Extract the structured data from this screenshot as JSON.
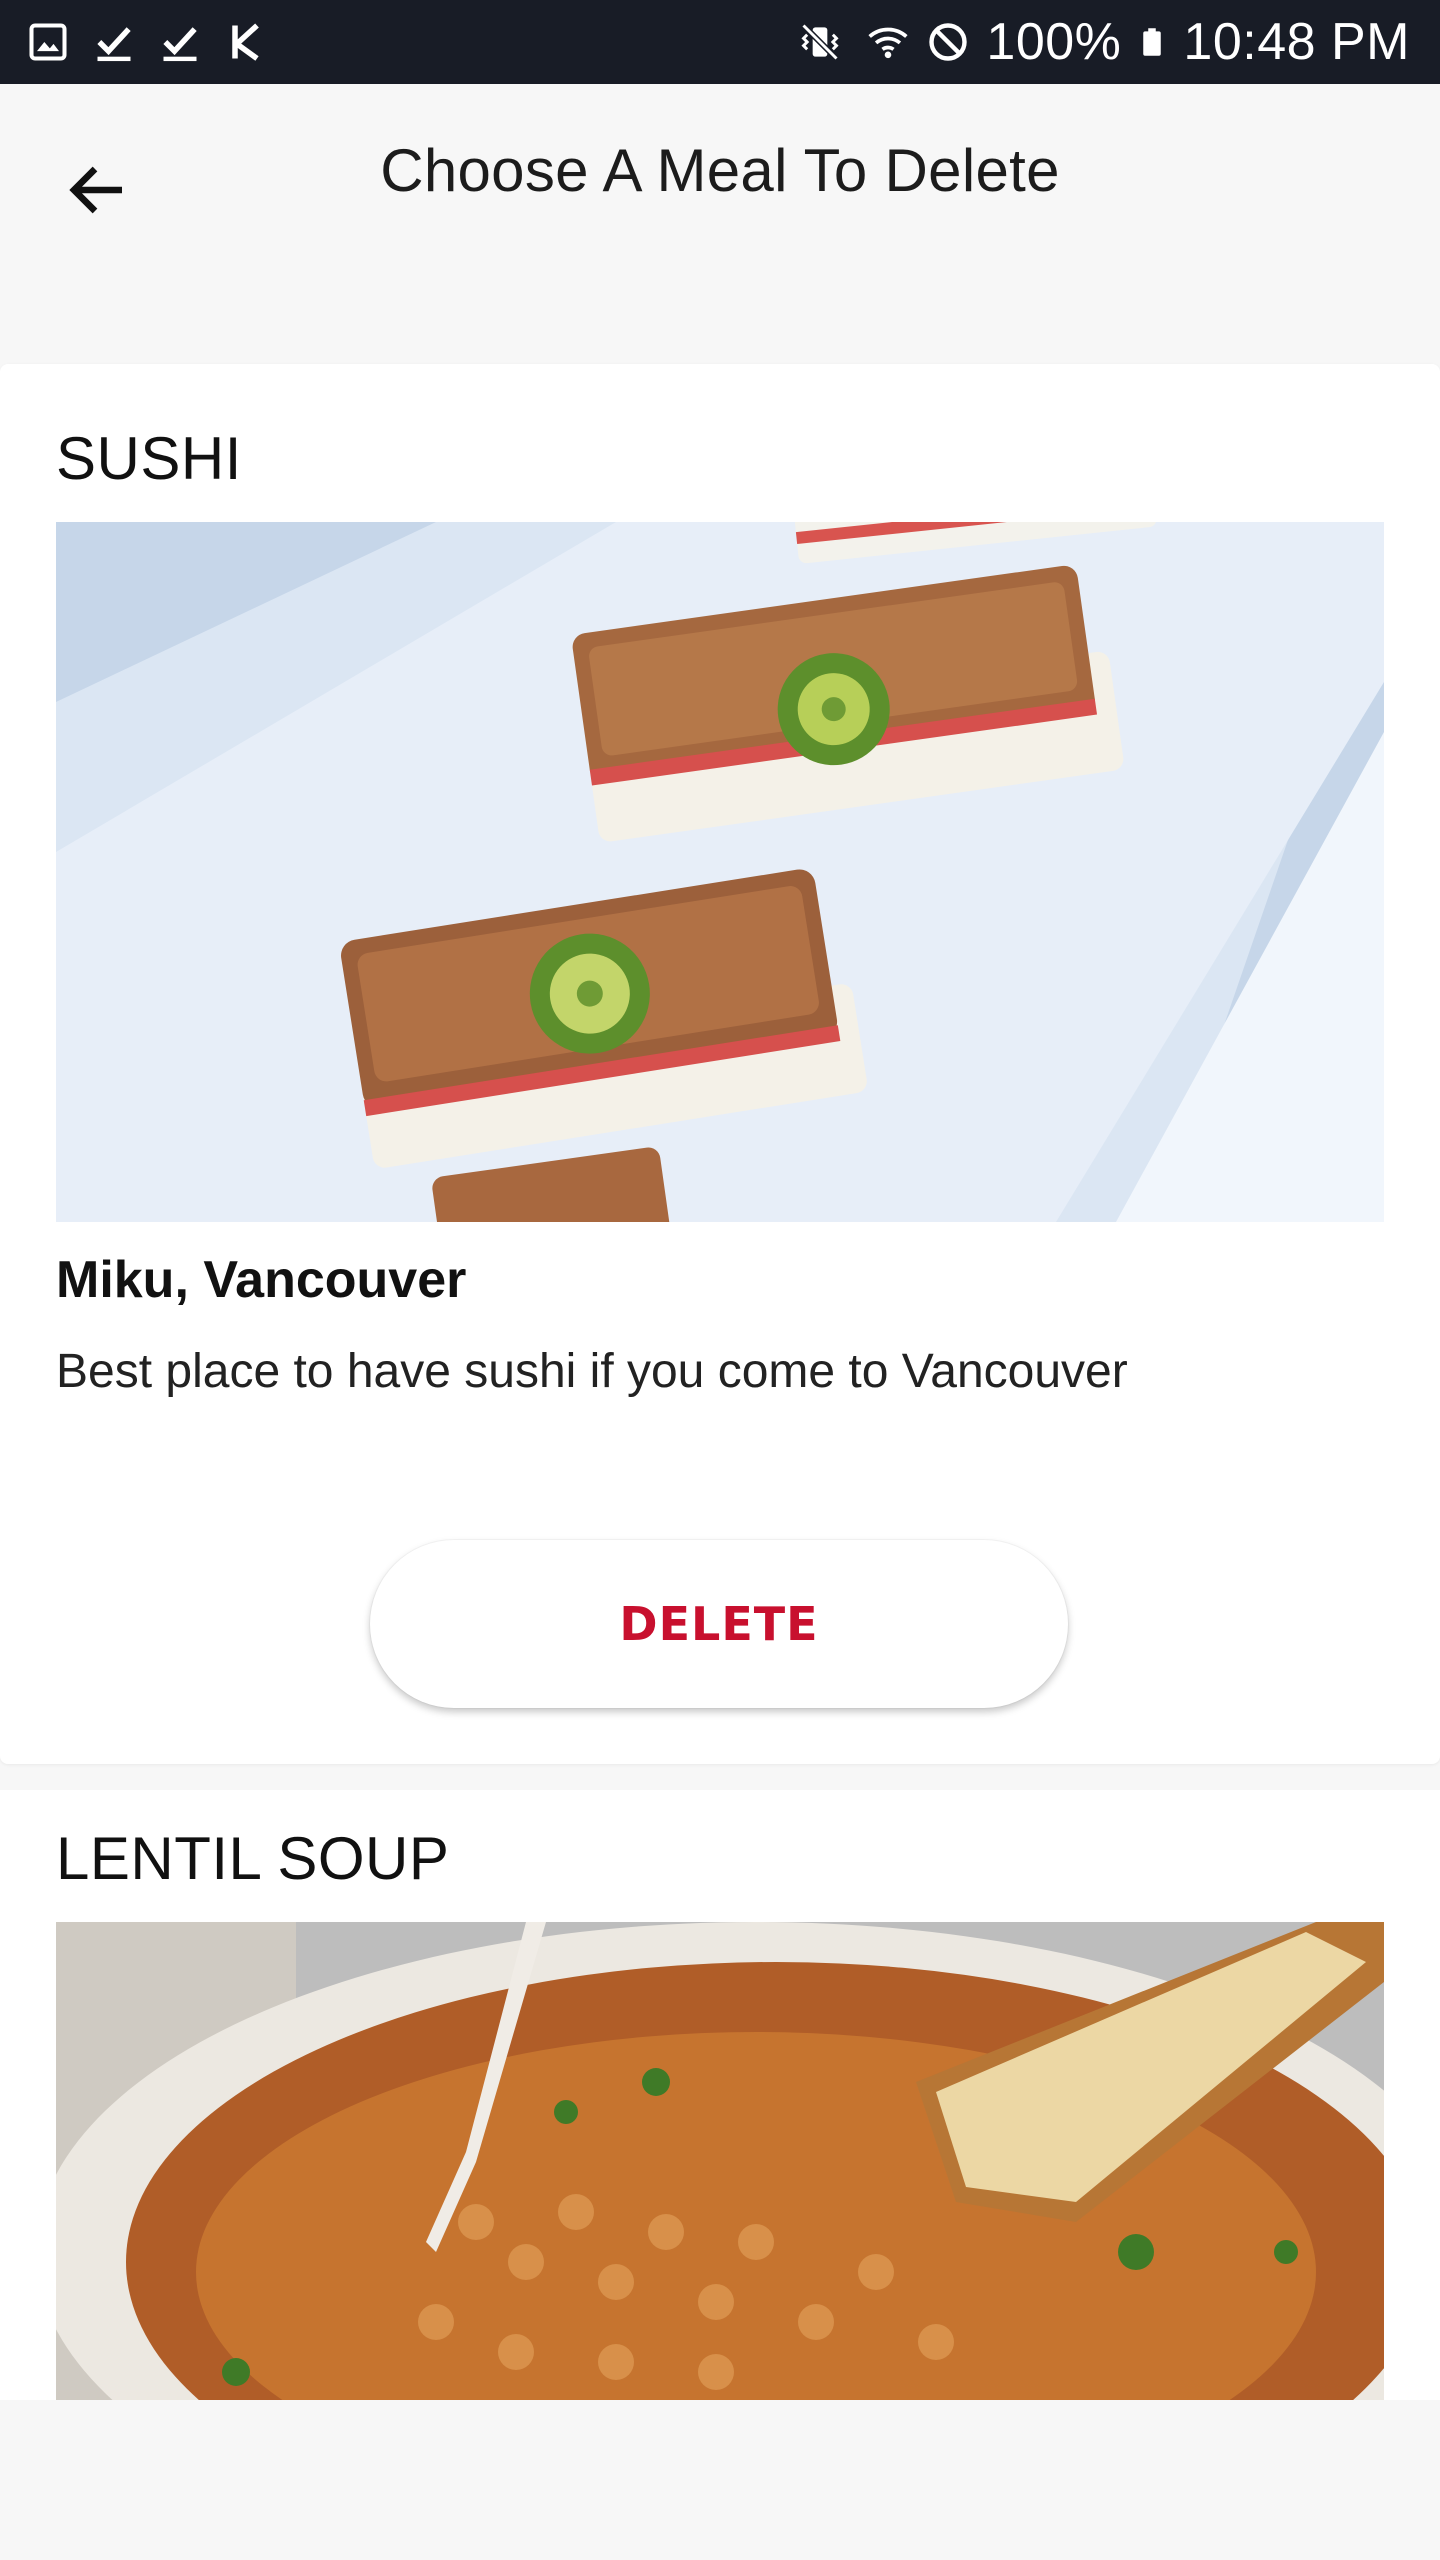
{
  "status_bar": {
    "battery": "100%",
    "time": "10:48 PM",
    "icons_left": [
      "image-icon",
      "check-icon",
      "check-icon",
      "k-app-icon"
    ],
    "icons_right": [
      "vibrate-icon",
      "wifi-icon",
      "do-not-disturb-icon",
      "battery-icon"
    ]
  },
  "app_bar": {
    "title": "Choose A Meal To Delete",
    "back_icon": "arrow-left-icon"
  },
  "meals": [
    {
      "name": "SUSHI",
      "place": "Miku, Vancouver",
      "description": "Best place to have sushi if you come to Vancouver",
      "button_label": "DELETE"
    },
    {
      "name": "LENTIL SOUP"
    }
  ],
  "colors": {
    "status_bar_bg": "#181c26",
    "background": "#f7f7f7",
    "delete_red": "#c8102e"
  }
}
